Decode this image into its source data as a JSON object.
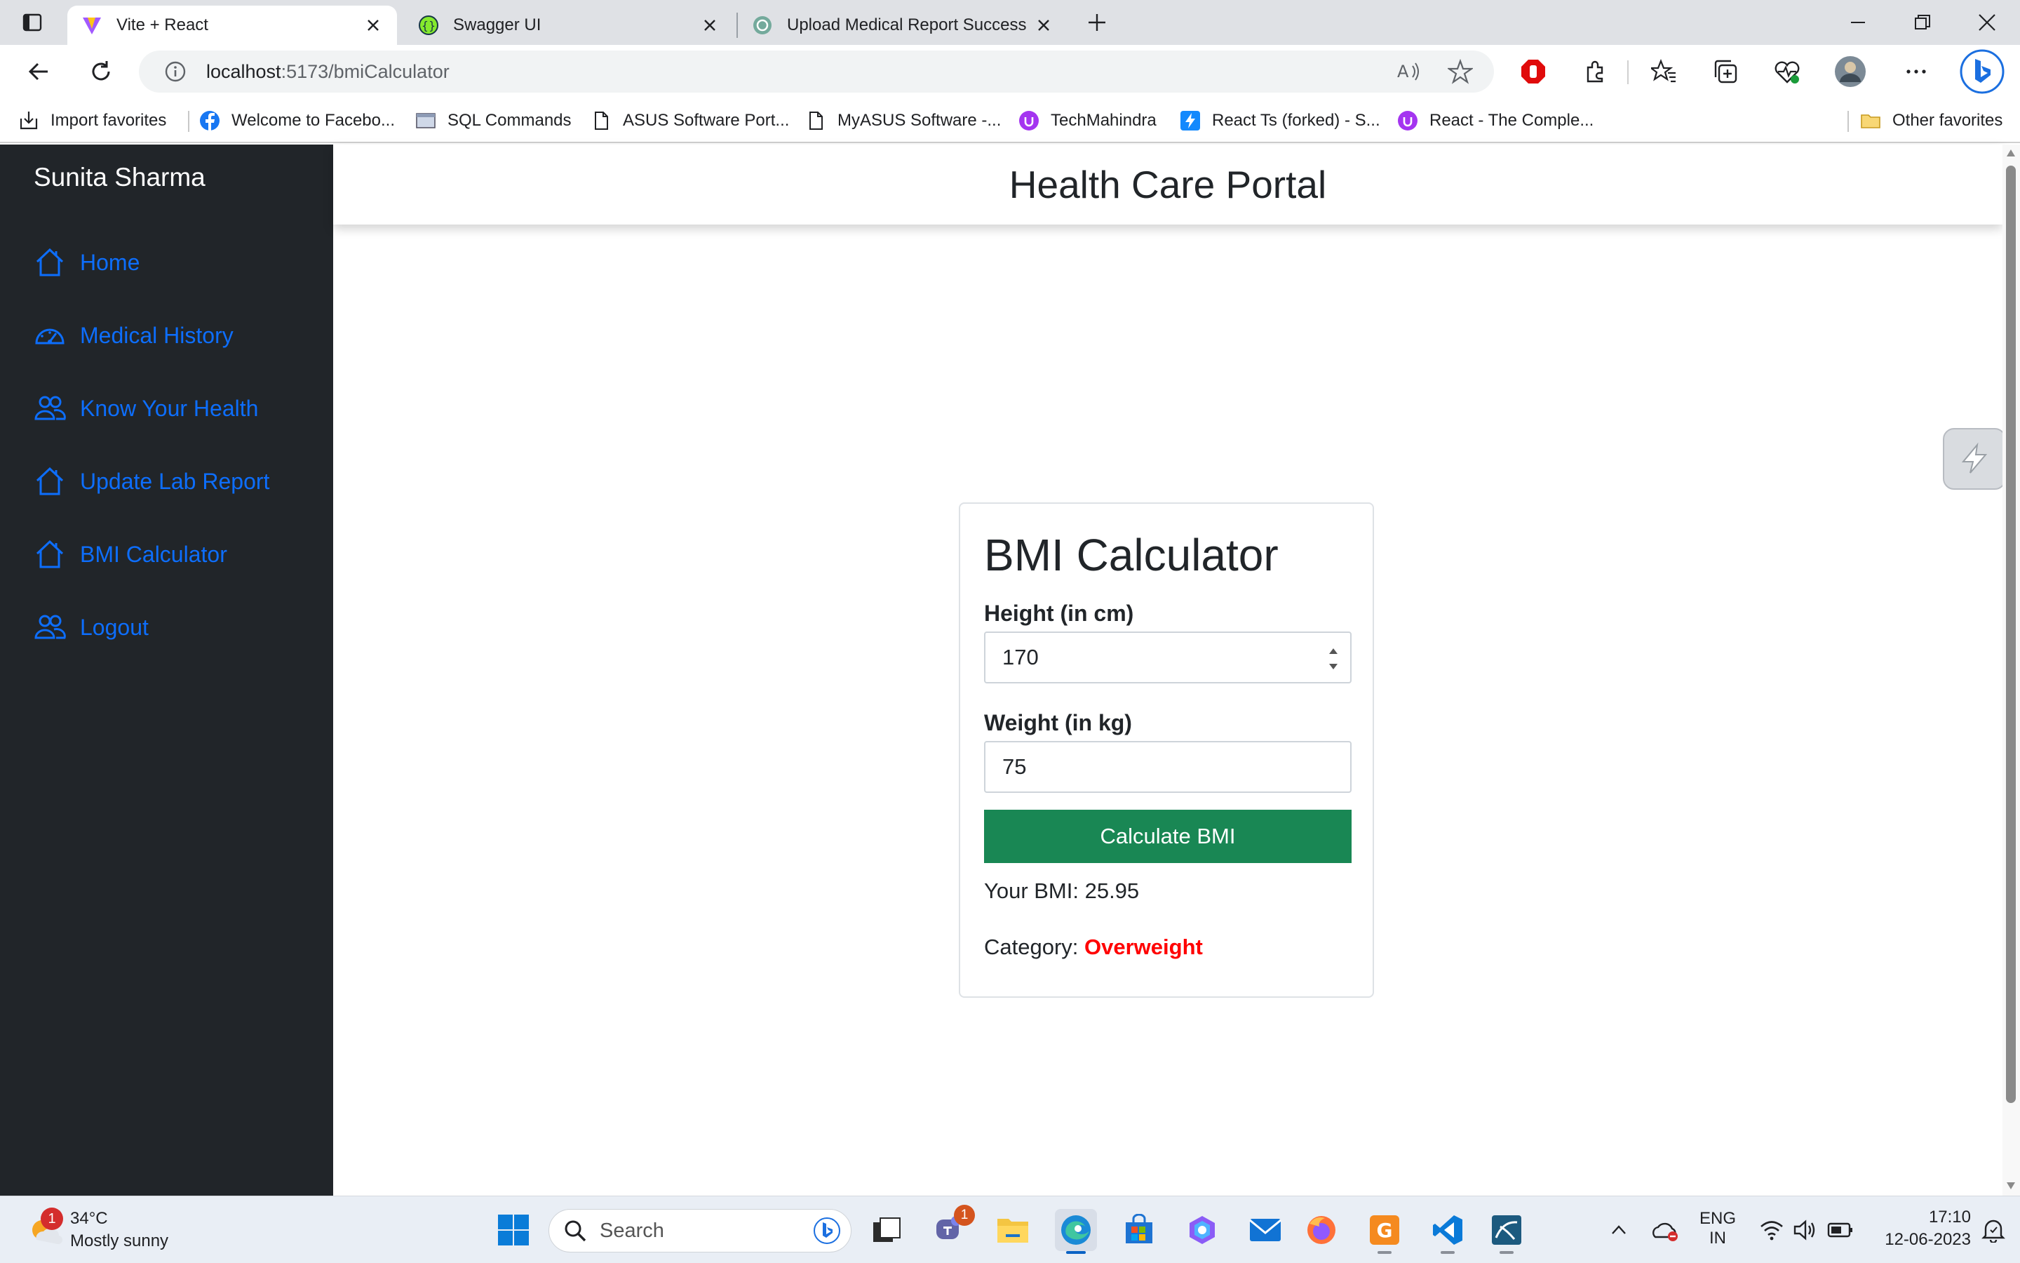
{
  "browser": {
    "tabs": [
      {
        "title": "Vite + React",
        "active": true
      },
      {
        "title": "Swagger UI",
        "active": false
      },
      {
        "title": "Upload Medical Report Success",
        "active": false
      }
    ],
    "address": {
      "host": "localhost",
      "path": ":5173/bmiCalculator"
    },
    "bookmarks": [
      "Import favorites",
      "Welcome to Facebo...",
      "SQL Commands",
      "ASUS Software Port...",
      "MyASUS Software -...",
      "TechMahindra",
      "React Ts (forked) - S...",
      "React - The Comple..."
    ],
    "other_favorites": "Other favorites"
  },
  "sidebar": {
    "user_name": "Sunita Sharma",
    "items": [
      {
        "label": "Home",
        "icon": "house-icon"
      },
      {
        "label": "Medical History",
        "icon": "speedometer-icon"
      },
      {
        "label": "Know Your Health",
        "icon": "people-icon"
      },
      {
        "label": "Update Lab Report",
        "icon": "house-icon"
      },
      {
        "label": "BMI Calculator",
        "icon": "house-icon"
      },
      {
        "label": "Logout",
        "icon": "people-icon"
      }
    ]
  },
  "main": {
    "title": "Health Care Portal",
    "card": {
      "title": "BMI Calculator",
      "height_label": "Height (in cm)",
      "height_value": "170",
      "weight_label": "Weight (in kg)",
      "weight_value": "75",
      "button_label": "Calculate BMI",
      "result": "Your BMI: 25.95",
      "category_label": "Category: ",
      "category_value": "Overweight"
    }
  },
  "taskbar": {
    "weather_temp": "34°C",
    "weather_desc": "Mostly sunny",
    "weather_badge": "1",
    "search_placeholder": "Search",
    "teams_badge": "1",
    "lang_top": "ENG",
    "lang_bottom": "IN",
    "time": "17:10",
    "date": "12-06-2023"
  },
  "colors": {
    "sidebar_bg": "#212529",
    "link_blue": "#0d6efd",
    "button_green": "#198754",
    "category_red": "#ff0000"
  }
}
